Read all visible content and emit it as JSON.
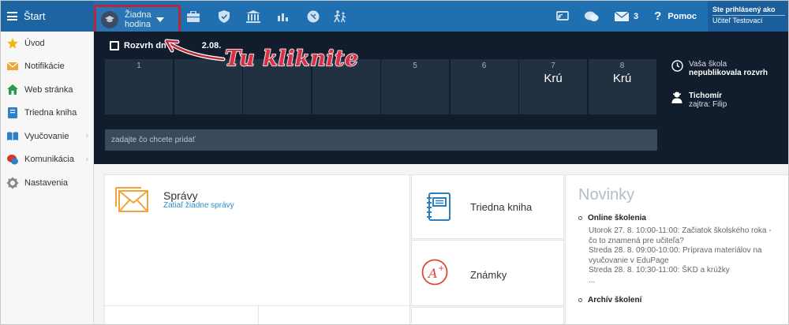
{
  "topbar": {
    "start_label": "Štart",
    "lesson_line1": "Žiadna",
    "lesson_line2": "hodina",
    "icons": [
      "briefcase-icon",
      "shield-icon",
      "building-icon",
      "bar-chart-icon",
      "badge-icon",
      "walking-icon"
    ],
    "messages_count": "3",
    "help_label": "Pomoc",
    "user_line1": "Ste prihlásený ako",
    "user_line2": "Učiteľ Testovací"
  },
  "sidebar": {
    "items": [
      {
        "label": "Úvod",
        "icon": "star-icon"
      },
      {
        "label": "Notifikácie",
        "icon": "envelope-icon"
      },
      {
        "label": "Web stránka",
        "icon": "home-icon"
      },
      {
        "label": "Triedna kniha",
        "icon": "book-icon"
      },
      {
        "label": "Vyučovanie",
        "icon": "open-book-icon"
      },
      {
        "label": "Komunikácia",
        "icon": "chat-icon"
      },
      {
        "label": "Nastavenia",
        "icon": "gear-icon"
      }
    ]
  },
  "timetable": {
    "title_start": "Rozvrh dn",
    "title_end": "2.08.",
    "slots": [
      {
        "num": "1",
        "subject": ""
      },
      {
        "num": "",
        "subject": ""
      },
      {
        "num": "",
        "subject": ""
      },
      {
        "num": "",
        "subject": ""
      },
      {
        "num": "5",
        "subject": ""
      },
      {
        "num": "6",
        "subject": ""
      },
      {
        "num": "7",
        "subject": "Krú"
      },
      {
        "num": "8",
        "subject": "Krú"
      }
    ],
    "info_school_line1": "Vaša škola",
    "info_school_line2": "nepublikovala rozvrh",
    "info_name": "Tichomír",
    "info_tomorrow": "zajtra: Filip",
    "add_placeholder": "zadajte čo chcete pridať"
  },
  "cards": {
    "spravy_title": "Správy",
    "spravy_sub": "Zatiaľ žiadne správy",
    "triedna_kniha": "Triedna kniha",
    "znamky": "Známky"
  },
  "novinky": {
    "heading": "Novinky",
    "item1_title": "Online školenia",
    "item1_lines": [
      "Utorok 27. 8. 10:00-11:00: Začiatok školského roka -",
      "čo to znamená pre učiteľa?",
      "Streda 28. 8. 09:00-10:00: Príprava materiálov na",
      "vyučovanie v EduPage",
      "Streda 28. 8. 10:30-11:00: ŠKD a krúžky",
      "..."
    ],
    "item2_title": "Archív školení"
  },
  "annotation": {
    "text": "Tu kliknite"
  },
  "colors": {
    "topbar": "#1f6fb1",
    "dark_band": "#111d2d",
    "highlight": "#b5283a",
    "annotation": "#d93046",
    "link": "#2b8cd1"
  }
}
